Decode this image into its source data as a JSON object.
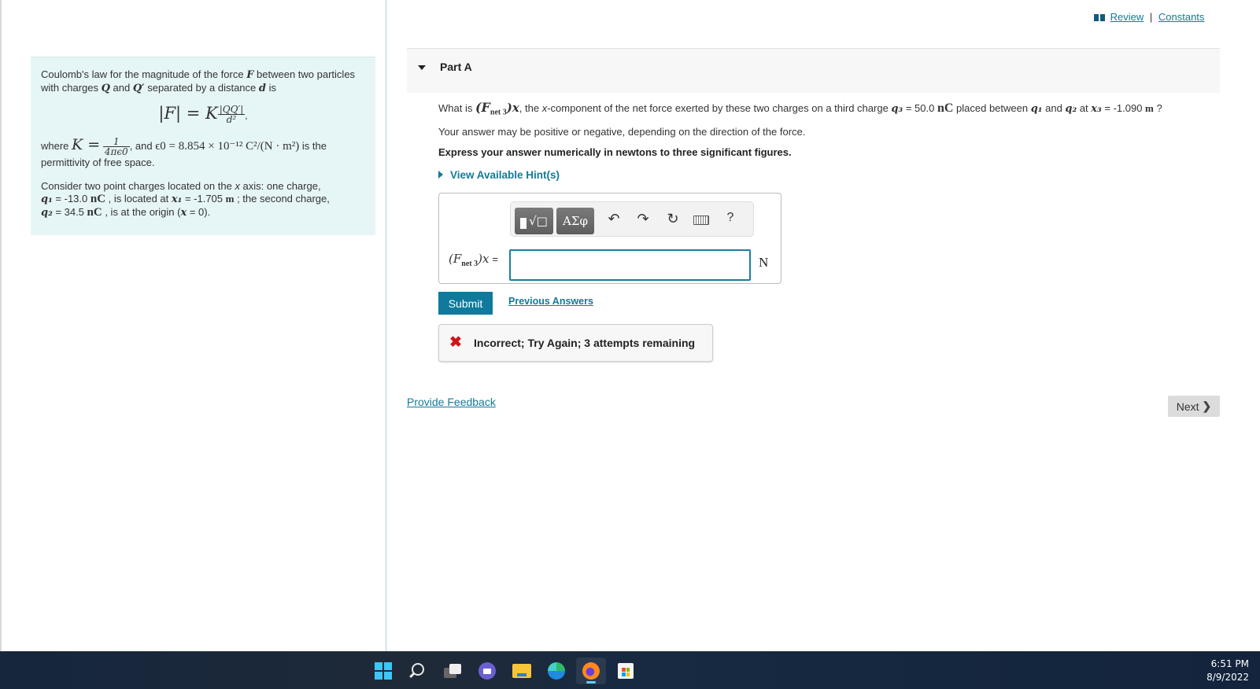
{
  "intro": {
    "para1_a": "Coulomb's law for the magnitude of the force ",
    "para1_F": "F",
    "para1_b": " between two particles with charges ",
    "para1_Q": "Q",
    "para1_c": " and ",
    "para1_Qp": "Q′",
    "para1_d": " separated by a distance ",
    "para1_dvar": "d",
    "para1_e": " is",
    "formula_lhs": "|F| = K",
    "formula_num": "|QQ′|",
    "formula_den": "d²",
    "formula_tail": ",",
    "para2_a": "where ",
    "para2_K": "K =",
    "para2_num": "1",
    "para2_den": "4πϵ0",
    "para2_b": ", and ",
    "para2_eps": "ϵ0 = 8.854 × 10⁻¹² C²/(N · m²)",
    "para2_c": " is the permittivity of free space.",
    "para3_a": "Consider two point charges located on the ",
    "para3_x": "x",
    "para3_b": " axis: one charge,",
    "q1_sym": "q₁",
    "q1_val": " = -13.0 ",
    "q1_unit": "nC",
    "q1_mid": " , is located at ",
    "x1_sym": "x₁",
    "x1_val": " = -1.705 ",
    "x1_unit": "m",
    "q1_tail": " ; the second charge,",
    "q2_sym": "q₂",
    "q2_val": " = 34.5 ",
    "q2_unit": "nC",
    "q2_tail": " , is at the origin (",
    "q2_x": "x",
    "q2_end": " = 0)."
  },
  "top_links": {
    "review": "Review",
    "separator": "|",
    "constants": "Constants"
  },
  "part": {
    "title": "Part A"
  },
  "question": {
    "a": "What is ",
    "sym": "(F",
    "sym_sub": "net 3",
    "sym_end": ")x",
    "b": ", the ",
    "b_x": "x",
    "c": "-component of the net force exerted by these two charges on a third charge ",
    "q3": "q₃",
    "q3_val": " = 50.0 ",
    "q3_unit": "nC",
    "d": " placed between ",
    "q1": "q₁",
    "e": " and ",
    "q2": "q₂",
    "f": " at ",
    "x3": "x₃",
    "x3_val": " = -1.090 ",
    "x3_unit": "m",
    "g": " ?",
    "note": "Your answer may be positive or negative, depending on the direction of the force.",
    "instruction": "Express your answer numerically in newtons to three significant figures.",
    "hint_label": "View Available Hint(s)"
  },
  "answer": {
    "toolbar": {
      "templates_label": "√□",
      "greek_label": "ΑΣφ",
      "undo": "↶",
      "redo": "↷",
      "reset": "↻",
      "help": "?"
    },
    "label_F": "(F",
    "label_sub": "net 3",
    "label_end": ")x",
    "label_eq": "=",
    "value": "",
    "unit": "N"
  },
  "actions": {
    "submit": "Submit",
    "previous_answers": "Previous Answers"
  },
  "feedback": {
    "icon": "✖",
    "message": "Incorrect; Try Again; 3 attempts remaining"
  },
  "footer": {
    "provide_feedback": "Provide Feedback",
    "next": "Next",
    "next_chevron": "❯"
  },
  "taskbar": {
    "apps": [
      "start",
      "search",
      "task-view",
      "teams-chat",
      "file-explorer",
      "edge",
      "firefox",
      "microsoft-store"
    ],
    "time": "6:51 PM",
    "date": "8/9/2022"
  }
}
